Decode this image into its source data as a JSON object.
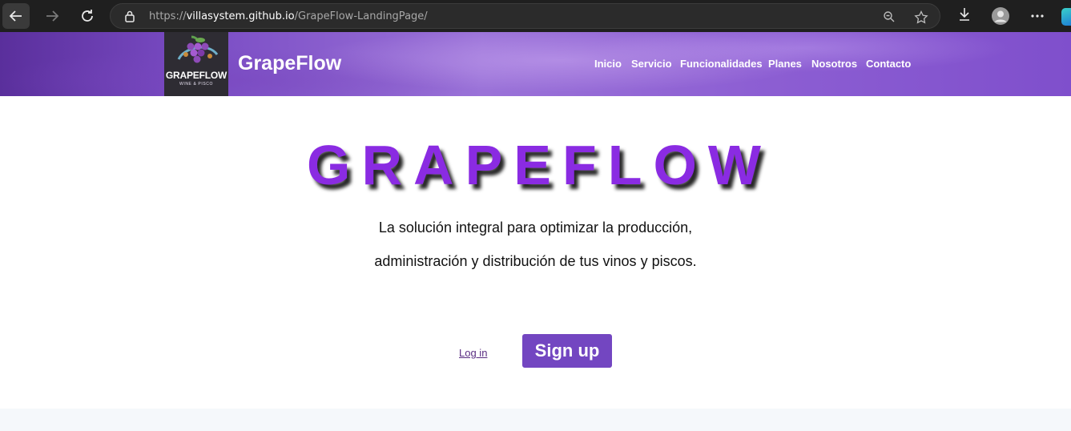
{
  "browser": {
    "url_scheme": "https://",
    "url_host": "villasystem.github.io",
    "url_path": "/GrapeFlow-LandingPage/",
    "icons": [
      "back-arrow-icon",
      "forward-arrow-icon",
      "reload-icon",
      "lock-icon",
      "zoom-icon",
      "star-icon",
      "download-icon",
      "profile-icon",
      "more-icon",
      "edge-copilot-icon"
    ]
  },
  "header": {
    "logo_text": "GRAPEFLOW",
    "logo_subtext": "WINE & PISCO",
    "brand": "GrapeFlow",
    "nav": [
      {
        "id": "inicio",
        "label": "Inicio"
      },
      {
        "id": "servicio",
        "label": "Servicio"
      },
      {
        "id": "funcionalidades",
        "label": "Funcionalidades"
      },
      {
        "id": "planes",
        "label": "Planes"
      },
      {
        "id": "nosotros",
        "label": "Nosotros"
      },
      {
        "id": "contacto",
        "label": "Contacto"
      }
    ]
  },
  "hero": {
    "title": "GRAPEFLOW",
    "line1": "La solución integral para optimizar la producción,",
    "line2": "administración y distribución de tus vinos y piscos.",
    "login_label": "Log in",
    "signup_label": "Sign up"
  },
  "colors": {
    "accent": "#8a2be2",
    "button": "#7346c1",
    "header_purple": "#8d5fd3"
  }
}
